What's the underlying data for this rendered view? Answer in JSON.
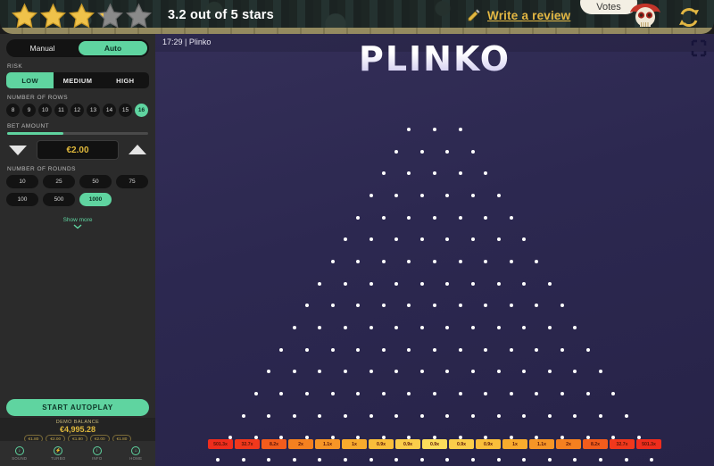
{
  "review_header": {
    "rating_text": "3.2 out of 5 stars",
    "rating_value": 3.2,
    "max_stars": 5,
    "write_review_label": "Write a review",
    "pencil_icon": "pencil-icon",
    "votes_label": "Votes",
    "skull_icon": "skull-icon",
    "refresh_icon": "refresh-icon",
    "star_filled_color": "#efc24a",
    "star_empty_color": "#8a8a8a"
  },
  "sidebar": {
    "mode": {
      "manual_label": "Manual",
      "auto_label": "Auto",
      "selected": "Auto"
    },
    "risk": {
      "label": "RISK",
      "options": [
        "LOW",
        "MEDIUM",
        "HIGH"
      ],
      "selected": "LOW"
    },
    "rows": {
      "label": "NUMBER OF ROWS",
      "options": [
        "8",
        "9",
        "10",
        "11",
        "12",
        "13",
        "14",
        "15",
        "16"
      ],
      "selected": "16"
    },
    "bet": {
      "label": "BET AMOUNT",
      "value": "€2.00",
      "slider_percent": 40,
      "decrease_icon": "triangle-down-icon",
      "increase_icon": "triangle-up-icon"
    },
    "rounds": {
      "label": "NUMBER OF ROUNDS",
      "options": [
        "10",
        "25",
        "50",
        "75",
        "100",
        "500",
        "1000"
      ],
      "selected": "1000"
    },
    "show_more_label": "Show more",
    "show_more_icon": "chevron-down-icon",
    "start_button_label": "START AUTOPLAY",
    "balance": {
      "label": "DEMO BALANCE",
      "value": "€4,995.28",
      "history": [
        "€1.80",
        "€2.00",
        "€1.80",
        "€2.00",
        "€1.80"
      ]
    },
    "nav": [
      {
        "label": "SOUND",
        "icon": "sound-icon",
        "glyph": "♪"
      },
      {
        "label": "TURBO",
        "icon": "turbo-icon",
        "glyph": "⚡"
      },
      {
        "label": "INFO",
        "icon": "info-icon",
        "glyph": "i"
      },
      {
        "label": "HOME",
        "icon": "home-icon",
        "glyph": "⌂"
      }
    ],
    "accent_color": "#5fd4a0"
  },
  "game": {
    "status_text": "17:29 | Plinko",
    "title": "PLINKO",
    "expand_icon": "expand-icon",
    "peg_rows": 16,
    "peg_top_count": 3,
    "multipliers": [
      "501.3x",
      "32.7x",
      "8.2x",
      "2x",
      "1.1x",
      "1x",
      "0.9x",
      "0.9x",
      "0.9x",
      "0.9x",
      "0.9x",
      "1x",
      "1.1x",
      "2x",
      "8.2x",
      "32.7x",
      "501.3x"
    ],
    "multiplier_colors": [
      "#ef2d1d",
      "#f0381c",
      "#f25c1c",
      "#f4801f",
      "#f69526",
      "#f8ab2d",
      "#fabe3a",
      "#fbcd4a",
      "#fcdd5b",
      "#fbcd4a",
      "#fabe3a",
      "#f8ab2d",
      "#f69526",
      "#f4801f",
      "#f25c1c",
      "#f0381c",
      "#ef2d1d"
    ],
    "board_bg": "#2f2b52"
  }
}
